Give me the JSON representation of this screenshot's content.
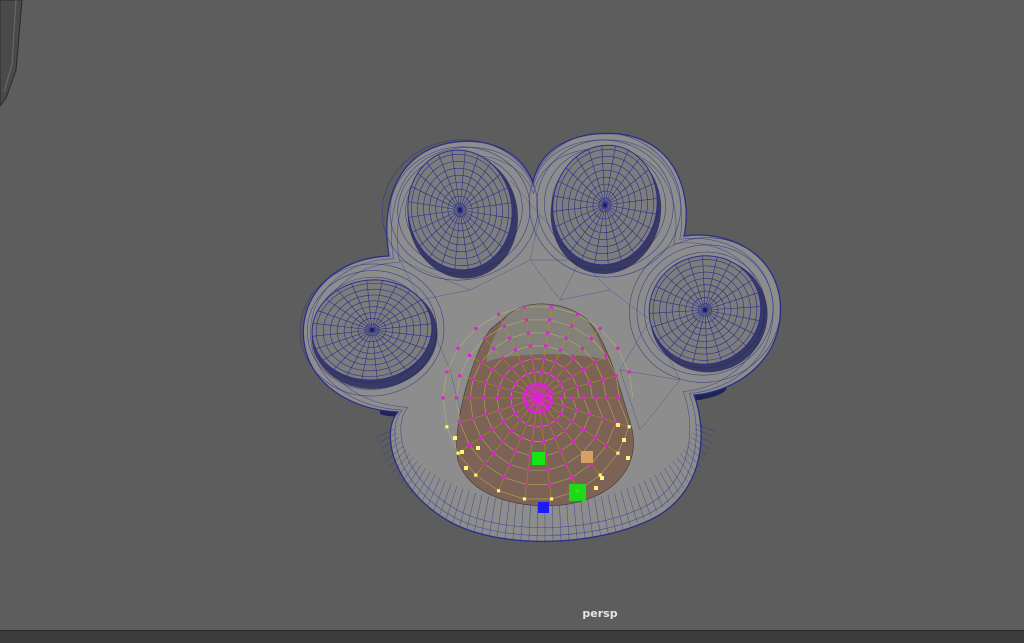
{
  "viewport": {
    "camera_name": "persp",
    "background_color": "#5d5d5d",
    "mesh_fill": "#8d8d8d",
    "toe_fill": "#7d7d7d",
    "wire_color": "#2b2f8a",
    "selected_vertex_color": "#e020d8",
    "selected_face_color": "#8a6e5c",
    "border_vertex_color": "#fff37a",
    "manipulator_colors": {
      "green": "#14e614",
      "blue": "#1a1aff",
      "tan": "#d9a066"
    }
  },
  "timeline": {
    "ticks": []
  }
}
